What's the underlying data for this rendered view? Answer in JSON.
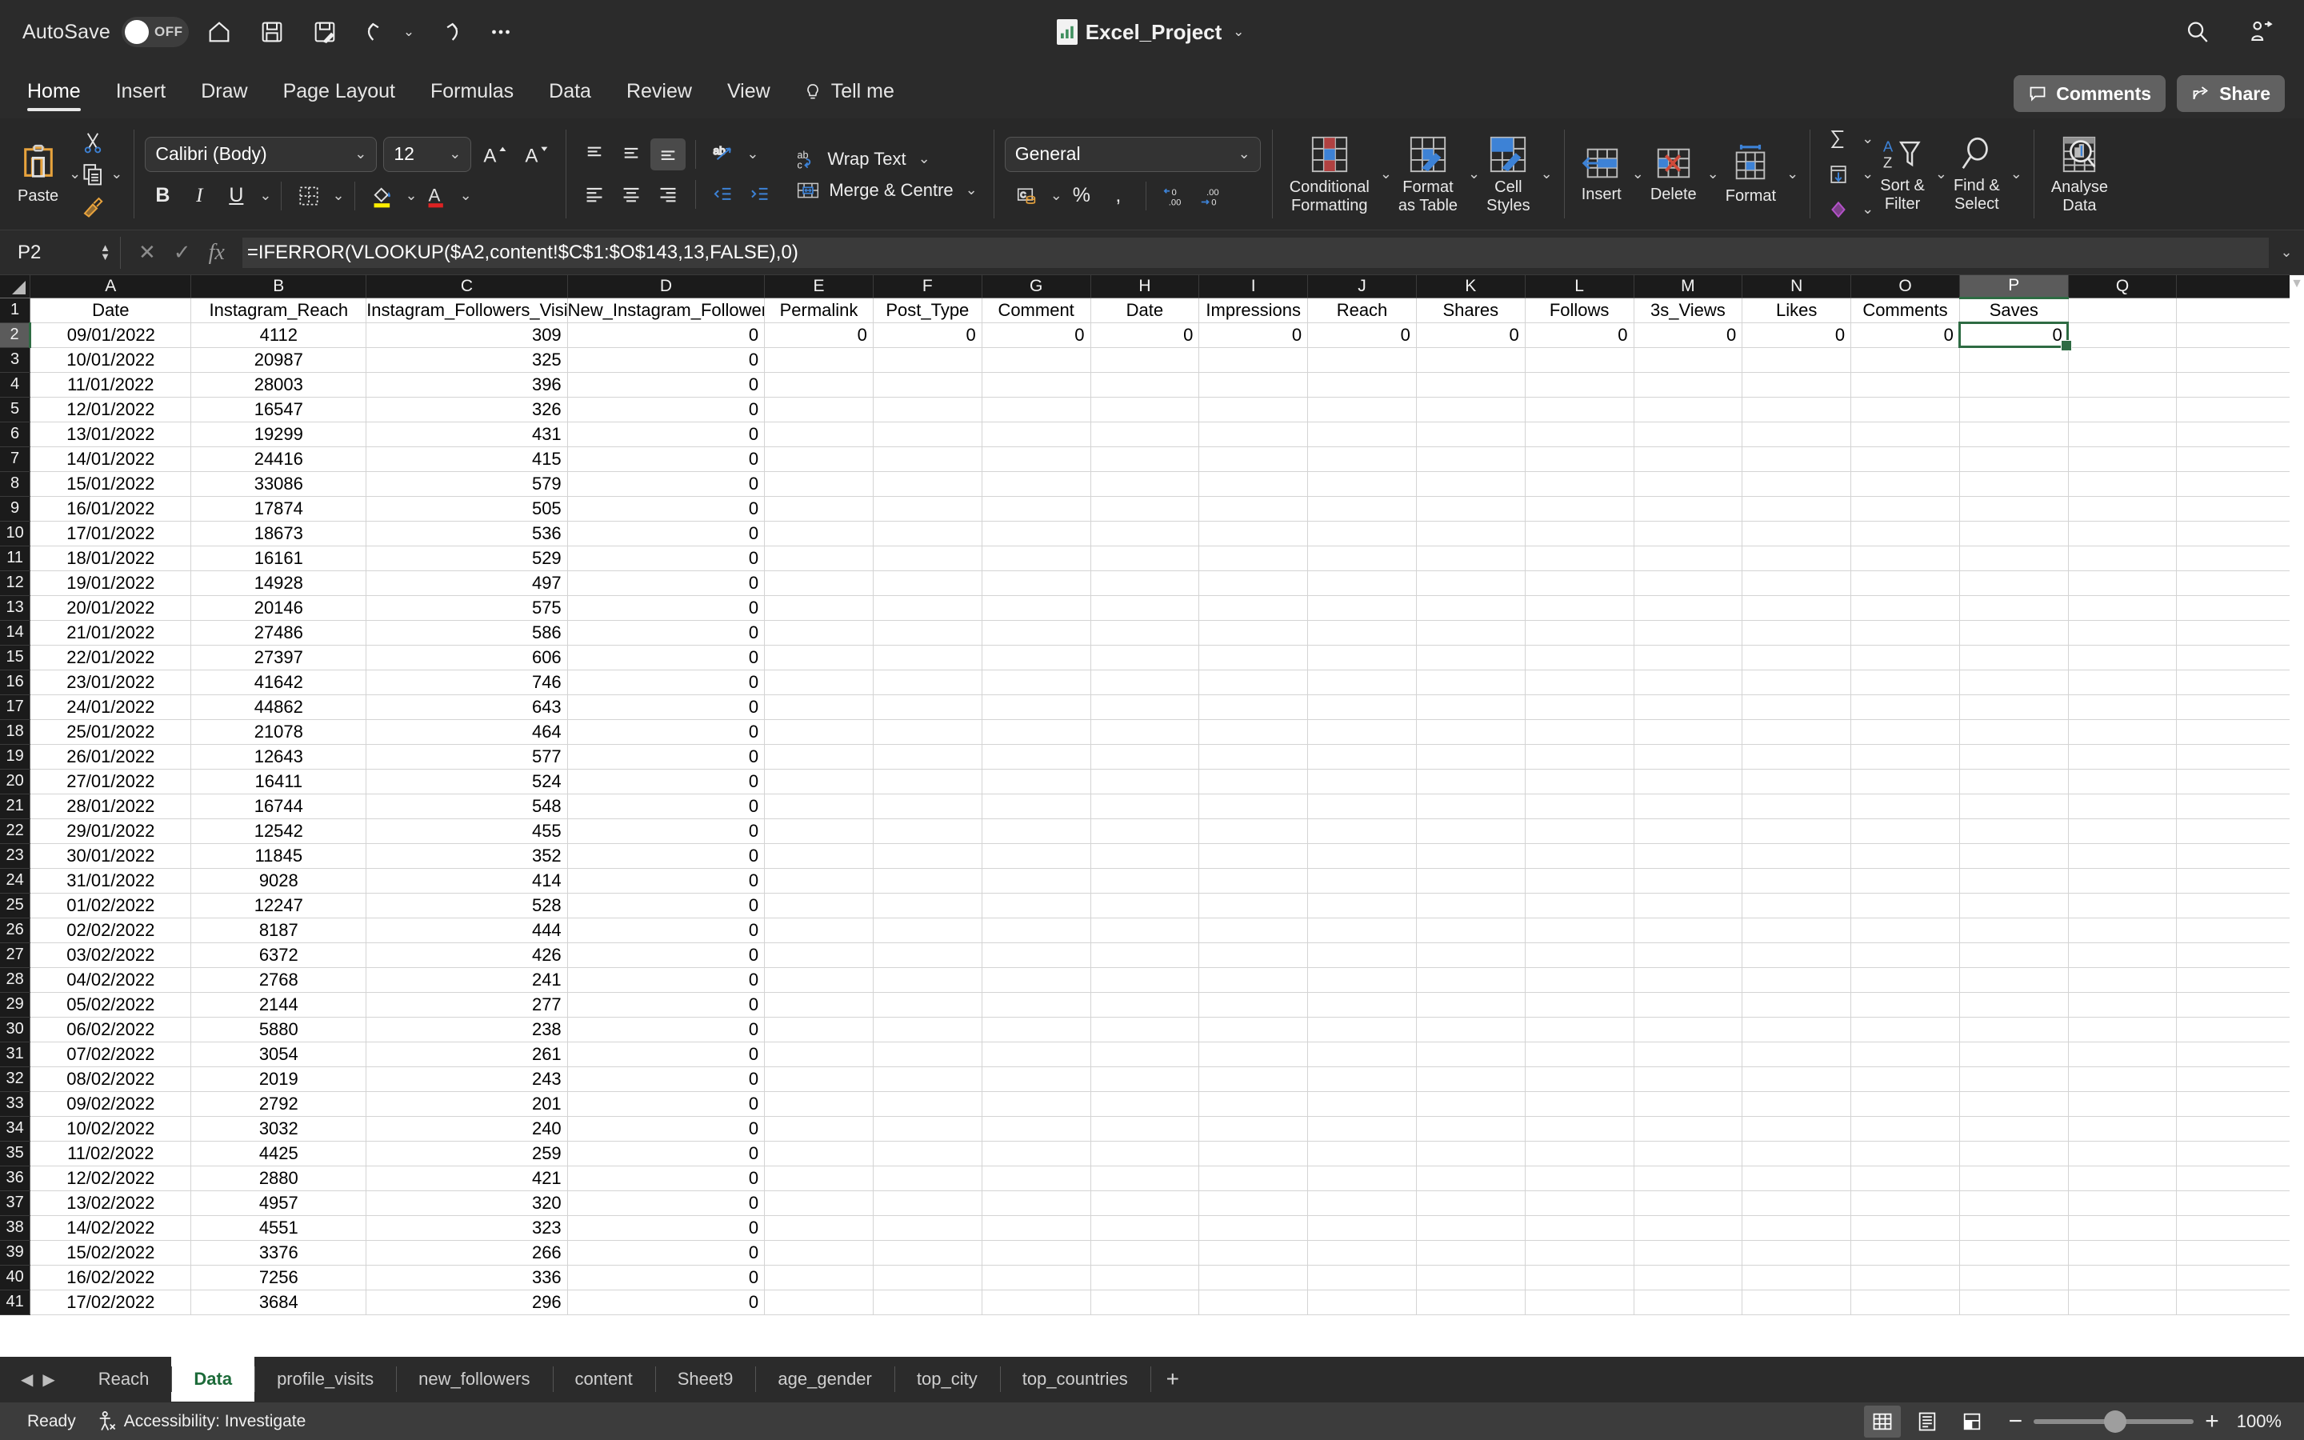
{
  "titlebar": {
    "autosave_label": "AutoSave",
    "autosave_state": "OFF",
    "doc_title": "Excel_Project",
    "quick_access": [
      {
        "name": "home-icon",
        "label": "Home"
      },
      {
        "name": "save-icon",
        "label": "Save"
      },
      {
        "name": "save-as-icon",
        "label": "Save As"
      },
      {
        "name": "undo-icon",
        "label": "Undo"
      },
      {
        "name": "redo-icon",
        "label": "Redo"
      },
      {
        "name": "more-icon",
        "label": "More"
      }
    ],
    "search_label": "Search",
    "account_label": "Account"
  },
  "ribbon_tabs": [
    {
      "label": "Home",
      "active": true
    },
    {
      "label": "Insert",
      "active": false
    },
    {
      "label": "Draw",
      "active": false
    },
    {
      "label": "Page Layout",
      "active": false
    },
    {
      "label": "Formulas",
      "active": false
    },
    {
      "label": "Data",
      "active": false
    },
    {
      "label": "Review",
      "active": false
    },
    {
      "label": "View",
      "active": false
    }
  ],
  "tell_me": "Tell me",
  "comments_label": "Comments",
  "share_label": "Share",
  "ribbon": {
    "paste_label": "Paste",
    "font_name": "Calibri (Body)",
    "font_size": "12",
    "grow_font": "A",
    "shrink_font": "A",
    "bold": "B",
    "italic": "I",
    "underline": "U",
    "wrap_text": "Wrap Text",
    "merge_centre": "Merge & Centre",
    "number_format": "General",
    "percent": "%",
    "comma": ",",
    "conditional_formatting": "Conditional\nFormatting",
    "conditional_formatting_l1": "Conditional",
    "conditional_formatting_l2": "Formatting",
    "format_as_table_l1": "Format",
    "format_as_table_l2": "as Table",
    "cell_styles_l1": "Cell",
    "cell_styles_l2": "Styles",
    "insert_label": "Insert",
    "delete_label": "Delete",
    "format_label": "Format",
    "sort_filter_l1": "Sort &",
    "sort_filter_l2": "Filter",
    "find_select_l1": "Find &",
    "find_select_l2": "Select",
    "analyse_data_l1": "Analyse",
    "analyse_data_l2": "Data"
  },
  "formula_bar": {
    "name_box": "P2",
    "cancel": "✕",
    "confirm": "✓",
    "fx": "fx",
    "formula": "=IFERROR(VLOOKUP($A2,content!$C$1:$O$143,13,FALSE),0)"
  },
  "grid": {
    "column_letters": [
      "A",
      "B",
      "C",
      "D",
      "E",
      "F",
      "G",
      "H",
      "I",
      "J",
      "K",
      "L",
      "M",
      "N",
      "O",
      "P",
      "Q"
    ],
    "selected_column": "P",
    "selected_row": 2,
    "selected_cell": "P2",
    "header_row": [
      "Date",
      "Instagram_Reach",
      "Instagram_Followers_Visit",
      "New_Instagram_Followers",
      "Permalink",
      "Post_Type",
      "Comment",
      "Date",
      "Impressions",
      "Reach",
      "Shares",
      "Follows",
      "3s_Views",
      "Likes",
      "Comments",
      "Saves",
      ""
    ],
    "row2_tail": [
      "0",
      "0",
      "0",
      "0",
      "0",
      "0",
      "0",
      "0",
      "0",
      "0",
      "0",
      "0"
    ],
    "rows": [
      {
        "n": 2,
        "date": "09/01/2022",
        "reach": "4112",
        "visits": "309",
        "newfollowers": "0"
      },
      {
        "n": 3,
        "date": "10/01/2022",
        "reach": "20987",
        "visits": "325",
        "newfollowers": "0"
      },
      {
        "n": 4,
        "date": "11/01/2022",
        "reach": "28003",
        "visits": "396",
        "newfollowers": "0"
      },
      {
        "n": 5,
        "date": "12/01/2022",
        "reach": "16547",
        "visits": "326",
        "newfollowers": "0"
      },
      {
        "n": 6,
        "date": "13/01/2022",
        "reach": "19299",
        "visits": "431",
        "newfollowers": "0"
      },
      {
        "n": 7,
        "date": "14/01/2022",
        "reach": "24416",
        "visits": "415",
        "newfollowers": "0"
      },
      {
        "n": 8,
        "date": "15/01/2022",
        "reach": "33086",
        "visits": "579",
        "newfollowers": "0"
      },
      {
        "n": 9,
        "date": "16/01/2022",
        "reach": "17874",
        "visits": "505",
        "newfollowers": "0"
      },
      {
        "n": 10,
        "date": "17/01/2022",
        "reach": "18673",
        "visits": "536",
        "newfollowers": "0"
      },
      {
        "n": 11,
        "date": "18/01/2022",
        "reach": "16161",
        "visits": "529",
        "newfollowers": "0"
      },
      {
        "n": 12,
        "date": "19/01/2022",
        "reach": "14928",
        "visits": "497",
        "newfollowers": "0"
      },
      {
        "n": 13,
        "date": "20/01/2022",
        "reach": "20146",
        "visits": "575",
        "newfollowers": "0"
      },
      {
        "n": 14,
        "date": "21/01/2022",
        "reach": "27486",
        "visits": "586",
        "newfollowers": "0"
      },
      {
        "n": 15,
        "date": "22/01/2022",
        "reach": "27397",
        "visits": "606",
        "newfollowers": "0"
      },
      {
        "n": 16,
        "date": "23/01/2022",
        "reach": "41642",
        "visits": "746",
        "newfollowers": "0"
      },
      {
        "n": 17,
        "date": "24/01/2022",
        "reach": "44862",
        "visits": "643",
        "newfollowers": "0"
      },
      {
        "n": 18,
        "date": "25/01/2022",
        "reach": "21078",
        "visits": "464",
        "newfollowers": "0"
      },
      {
        "n": 19,
        "date": "26/01/2022",
        "reach": "12643",
        "visits": "577",
        "newfollowers": "0"
      },
      {
        "n": 20,
        "date": "27/01/2022",
        "reach": "16411",
        "visits": "524",
        "newfollowers": "0"
      },
      {
        "n": 21,
        "date": "28/01/2022",
        "reach": "16744",
        "visits": "548",
        "newfollowers": "0"
      },
      {
        "n": 22,
        "date": "29/01/2022",
        "reach": "12542",
        "visits": "455",
        "newfollowers": "0"
      },
      {
        "n": 23,
        "date": "30/01/2022",
        "reach": "11845",
        "visits": "352",
        "newfollowers": "0"
      },
      {
        "n": 24,
        "date": "31/01/2022",
        "reach": "9028",
        "visits": "414",
        "newfollowers": "0"
      },
      {
        "n": 25,
        "date": "01/02/2022",
        "reach": "12247",
        "visits": "528",
        "newfollowers": "0"
      },
      {
        "n": 26,
        "date": "02/02/2022",
        "reach": "8187",
        "visits": "444",
        "newfollowers": "0"
      },
      {
        "n": 27,
        "date": "03/02/2022",
        "reach": "6372",
        "visits": "426",
        "newfollowers": "0"
      },
      {
        "n": 28,
        "date": "04/02/2022",
        "reach": "2768",
        "visits": "241",
        "newfollowers": "0"
      },
      {
        "n": 29,
        "date": "05/02/2022",
        "reach": "2144",
        "visits": "277",
        "newfollowers": "0"
      },
      {
        "n": 30,
        "date": "06/02/2022",
        "reach": "5880",
        "visits": "238",
        "newfollowers": "0"
      },
      {
        "n": 31,
        "date": "07/02/2022",
        "reach": "3054",
        "visits": "261",
        "newfollowers": "0"
      },
      {
        "n": 32,
        "date": "08/02/2022",
        "reach": "2019",
        "visits": "243",
        "newfollowers": "0"
      },
      {
        "n": 33,
        "date": "09/02/2022",
        "reach": "2792",
        "visits": "201",
        "newfollowers": "0"
      },
      {
        "n": 34,
        "date": "10/02/2022",
        "reach": "3032",
        "visits": "240",
        "newfollowers": "0"
      },
      {
        "n": 35,
        "date": "11/02/2022",
        "reach": "4425",
        "visits": "259",
        "newfollowers": "0"
      },
      {
        "n": 36,
        "date": "12/02/2022",
        "reach": "2880",
        "visits": "421",
        "newfollowers": "0"
      },
      {
        "n": 37,
        "date": "13/02/2022",
        "reach": "4957",
        "visits": "320",
        "newfollowers": "0"
      },
      {
        "n": 38,
        "date": "14/02/2022",
        "reach": "4551",
        "visits": "323",
        "newfollowers": "0"
      },
      {
        "n": 39,
        "date": "15/02/2022",
        "reach": "3376",
        "visits": "266",
        "newfollowers": "0"
      },
      {
        "n": 40,
        "date": "16/02/2022",
        "reach": "7256",
        "visits": "336",
        "newfollowers": "0"
      },
      {
        "n": 41,
        "date": "17/02/2022",
        "reach": "3684",
        "visits": "296",
        "newfollowers": "0"
      }
    ]
  },
  "sheet_tabs": [
    {
      "label": "Reach",
      "active": false
    },
    {
      "label": "Data",
      "active": true
    },
    {
      "label": "profile_visits",
      "active": false
    },
    {
      "label": "new_followers",
      "active": false
    },
    {
      "label": "content",
      "active": false
    },
    {
      "label": "Sheet9",
      "active": false
    },
    {
      "label": "age_gender",
      "active": false
    },
    {
      "label": "top_city",
      "active": false
    },
    {
      "label": "top_countries",
      "active": false
    }
  ],
  "add_sheet_label": "+",
  "statusbar": {
    "ready": "Ready",
    "accessibility": "Accessibility: Investigate",
    "zoom_minus": "−",
    "zoom_plus": "+",
    "zoom_level": "100%"
  },
  "colors": {
    "accent_green": "#2e6b43",
    "chrome_dark": "#2b2b2b",
    "ribbon_bg": "#282828",
    "status_bg": "#3c3c3c",
    "blue_icon": "#3d82d6",
    "red_icon": "#c0392b",
    "yellow_highlight": "#ffee00",
    "orange": "#e8a33d"
  }
}
